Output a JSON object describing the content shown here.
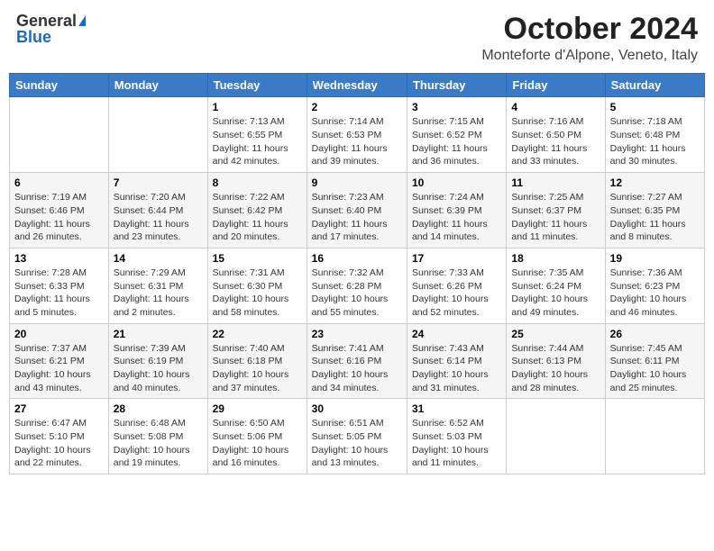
{
  "header": {
    "logo_general": "General",
    "logo_blue": "Blue",
    "month_title": "October 2024",
    "location": "Monteforte d'Alpone, Veneto, Italy"
  },
  "weekdays": [
    "Sunday",
    "Monday",
    "Tuesday",
    "Wednesday",
    "Thursday",
    "Friday",
    "Saturday"
  ],
  "weeks": [
    [
      {
        "day": "",
        "sunrise": "",
        "sunset": "",
        "daylight": ""
      },
      {
        "day": "",
        "sunrise": "",
        "sunset": "",
        "daylight": ""
      },
      {
        "day": "1",
        "sunrise": "Sunrise: 7:13 AM",
        "sunset": "Sunset: 6:55 PM",
        "daylight": "Daylight: 11 hours and 42 minutes."
      },
      {
        "day": "2",
        "sunrise": "Sunrise: 7:14 AM",
        "sunset": "Sunset: 6:53 PM",
        "daylight": "Daylight: 11 hours and 39 minutes."
      },
      {
        "day": "3",
        "sunrise": "Sunrise: 7:15 AM",
        "sunset": "Sunset: 6:52 PM",
        "daylight": "Daylight: 11 hours and 36 minutes."
      },
      {
        "day": "4",
        "sunrise": "Sunrise: 7:16 AM",
        "sunset": "Sunset: 6:50 PM",
        "daylight": "Daylight: 11 hours and 33 minutes."
      },
      {
        "day": "5",
        "sunrise": "Sunrise: 7:18 AM",
        "sunset": "Sunset: 6:48 PM",
        "daylight": "Daylight: 11 hours and 30 minutes."
      }
    ],
    [
      {
        "day": "6",
        "sunrise": "Sunrise: 7:19 AM",
        "sunset": "Sunset: 6:46 PM",
        "daylight": "Daylight: 11 hours and 26 minutes."
      },
      {
        "day": "7",
        "sunrise": "Sunrise: 7:20 AM",
        "sunset": "Sunset: 6:44 PM",
        "daylight": "Daylight: 11 hours and 23 minutes."
      },
      {
        "day": "8",
        "sunrise": "Sunrise: 7:22 AM",
        "sunset": "Sunset: 6:42 PM",
        "daylight": "Daylight: 11 hours and 20 minutes."
      },
      {
        "day": "9",
        "sunrise": "Sunrise: 7:23 AM",
        "sunset": "Sunset: 6:40 PM",
        "daylight": "Daylight: 11 hours and 17 minutes."
      },
      {
        "day": "10",
        "sunrise": "Sunrise: 7:24 AM",
        "sunset": "Sunset: 6:39 PM",
        "daylight": "Daylight: 11 hours and 14 minutes."
      },
      {
        "day": "11",
        "sunrise": "Sunrise: 7:25 AM",
        "sunset": "Sunset: 6:37 PM",
        "daylight": "Daylight: 11 hours and 11 minutes."
      },
      {
        "day": "12",
        "sunrise": "Sunrise: 7:27 AM",
        "sunset": "Sunset: 6:35 PM",
        "daylight": "Daylight: 11 hours and 8 minutes."
      }
    ],
    [
      {
        "day": "13",
        "sunrise": "Sunrise: 7:28 AM",
        "sunset": "Sunset: 6:33 PM",
        "daylight": "Daylight: 11 hours and 5 minutes."
      },
      {
        "day": "14",
        "sunrise": "Sunrise: 7:29 AM",
        "sunset": "Sunset: 6:31 PM",
        "daylight": "Daylight: 11 hours and 2 minutes."
      },
      {
        "day": "15",
        "sunrise": "Sunrise: 7:31 AM",
        "sunset": "Sunset: 6:30 PM",
        "daylight": "Daylight: 10 hours and 58 minutes."
      },
      {
        "day": "16",
        "sunrise": "Sunrise: 7:32 AM",
        "sunset": "Sunset: 6:28 PM",
        "daylight": "Daylight: 10 hours and 55 minutes."
      },
      {
        "day": "17",
        "sunrise": "Sunrise: 7:33 AM",
        "sunset": "Sunset: 6:26 PM",
        "daylight": "Daylight: 10 hours and 52 minutes."
      },
      {
        "day": "18",
        "sunrise": "Sunrise: 7:35 AM",
        "sunset": "Sunset: 6:24 PM",
        "daylight": "Daylight: 10 hours and 49 minutes."
      },
      {
        "day": "19",
        "sunrise": "Sunrise: 7:36 AM",
        "sunset": "Sunset: 6:23 PM",
        "daylight": "Daylight: 10 hours and 46 minutes."
      }
    ],
    [
      {
        "day": "20",
        "sunrise": "Sunrise: 7:37 AM",
        "sunset": "Sunset: 6:21 PM",
        "daylight": "Daylight: 10 hours and 43 minutes."
      },
      {
        "day": "21",
        "sunrise": "Sunrise: 7:39 AM",
        "sunset": "Sunset: 6:19 PM",
        "daylight": "Daylight: 10 hours and 40 minutes."
      },
      {
        "day": "22",
        "sunrise": "Sunrise: 7:40 AM",
        "sunset": "Sunset: 6:18 PM",
        "daylight": "Daylight: 10 hours and 37 minutes."
      },
      {
        "day": "23",
        "sunrise": "Sunrise: 7:41 AM",
        "sunset": "Sunset: 6:16 PM",
        "daylight": "Daylight: 10 hours and 34 minutes."
      },
      {
        "day": "24",
        "sunrise": "Sunrise: 7:43 AM",
        "sunset": "Sunset: 6:14 PM",
        "daylight": "Daylight: 10 hours and 31 minutes."
      },
      {
        "day": "25",
        "sunrise": "Sunrise: 7:44 AM",
        "sunset": "Sunset: 6:13 PM",
        "daylight": "Daylight: 10 hours and 28 minutes."
      },
      {
        "day": "26",
        "sunrise": "Sunrise: 7:45 AM",
        "sunset": "Sunset: 6:11 PM",
        "daylight": "Daylight: 10 hours and 25 minutes."
      }
    ],
    [
      {
        "day": "27",
        "sunrise": "Sunrise: 6:47 AM",
        "sunset": "Sunset: 5:10 PM",
        "daylight": "Daylight: 10 hours and 22 minutes."
      },
      {
        "day": "28",
        "sunrise": "Sunrise: 6:48 AM",
        "sunset": "Sunset: 5:08 PM",
        "daylight": "Daylight: 10 hours and 19 minutes."
      },
      {
        "day": "29",
        "sunrise": "Sunrise: 6:50 AM",
        "sunset": "Sunset: 5:06 PM",
        "daylight": "Daylight: 10 hours and 16 minutes."
      },
      {
        "day": "30",
        "sunrise": "Sunrise: 6:51 AM",
        "sunset": "Sunset: 5:05 PM",
        "daylight": "Daylight: 10 hours and 13 minutes."
      },
      {
        "day": "31",
        "sunrise": "Sunrise: 6:52 AM",
        "sunset": "Sunset: 5:03 PM",
        "daylight": "Daylight: 10 hours and 11 minutes."
      },
      {
        "day": "",
        "sunrise": "",
        "sunset": "",
        "daylight": ""
      },
      {
        "day": "",
        "sunrise": "",
        "sunset": "",
        "daylight": ""
      }
    ]
  ]
}
